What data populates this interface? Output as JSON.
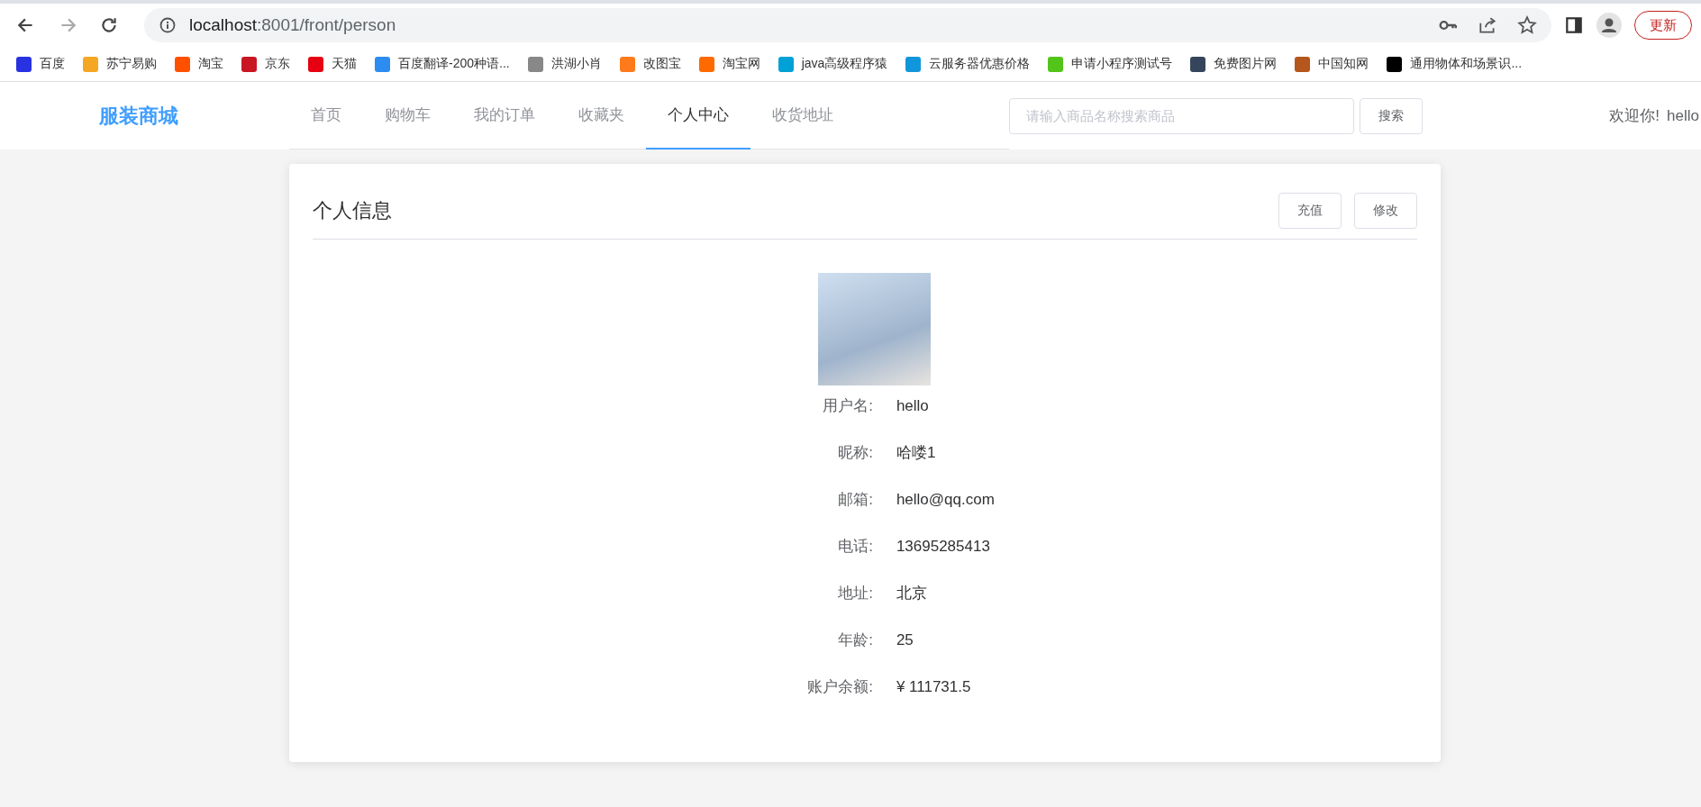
{
  "browser": {
    "url_host": "localhost",
    "url_path": ":8001/front/person",
    "update_button": "更新"
  },
  "bookmarks": [
    {
      "label": "百度",
      "color": "#2932e1"
    },
    {
      "label": "苏宁易购",
      "color": "#f5a623"
    },
    {
      "label": "淘宝",
      "color": "#ff5000"
    },
    {
      "label": "京东",
      "color": "#c91623"
    },
    {
      "label": "天猫",
      "color": "#e60012"
    },
    {
      "label": "百度翻译-200种语...",
      "color": "#2d8cf0"
    },
    {
      "label": "洪湖小肖",
      "color": "#888888"
    },
    {
      "label": "改图宝",
      "color": "#ff7a1a"
    },
    {
      "label": "淘宝网",
      "color": "#ff6a00"
    },
    {
      "label": "java高级程序猿",
      "color": "#00a1d6"
    },
    {
      "label": "云服务器优惠价格",
      "color": "#1296db"
    },
    {
      "label": "申请小程序测试号",
      "color": "#52c41a"
    },
    {
      "label": "免费图片网",
      "color": "#35465c"
    },
    {
      "label": "中国知网",
      "color": "#b5561c"
    },
    {
      "label": "通用物体和场景识...",
      "color": "#000000"
    }
  ],
  "header": {
    "logo": "服装商城",
    "nav": [
      {
        "label": "首页",
        "selected": false
      },
      {
        "label": "购物车",
        "selected": false
      },
      {
        "label": "我的订单",
        "selected": false
      },
      {
        "label": "收藏夹",
        "selected": false
      },
      {
        "label": "个人中心",
        "selected": true
      },
      {
        "label": "收货地址",
        "selected": false
      }
    ],
    "search": {
      "placeholder": "请输入商品名称搜索商品",
      "button": "搜索"
    },
    "welcome": "欢迎你!",
    "username": "hello"
  },
  "card": {
    "title": "个人信息",
    "buttons": [
      "充值",
      "修改"
    ],
    "fields": [
      {
        "label": "用户名:",
        "value": "hello"
      },
      {
        "label": "昵称:",
        "value": "哈喽1"
      },
      {
        "label": "邮箱:",
        "value": "hello@qq.com"
      },
      {
        "label": "电话:",
        "value": "13695285413"
      },
      {
        "label": "地址:",
        "value": "北京"
      },
      {
        "label": "年龄:",
        "value": "25"
      },
      {
        "label": "账户余额:",
        "value": "¥ 111731.5"
      }
    ]
  }
}
